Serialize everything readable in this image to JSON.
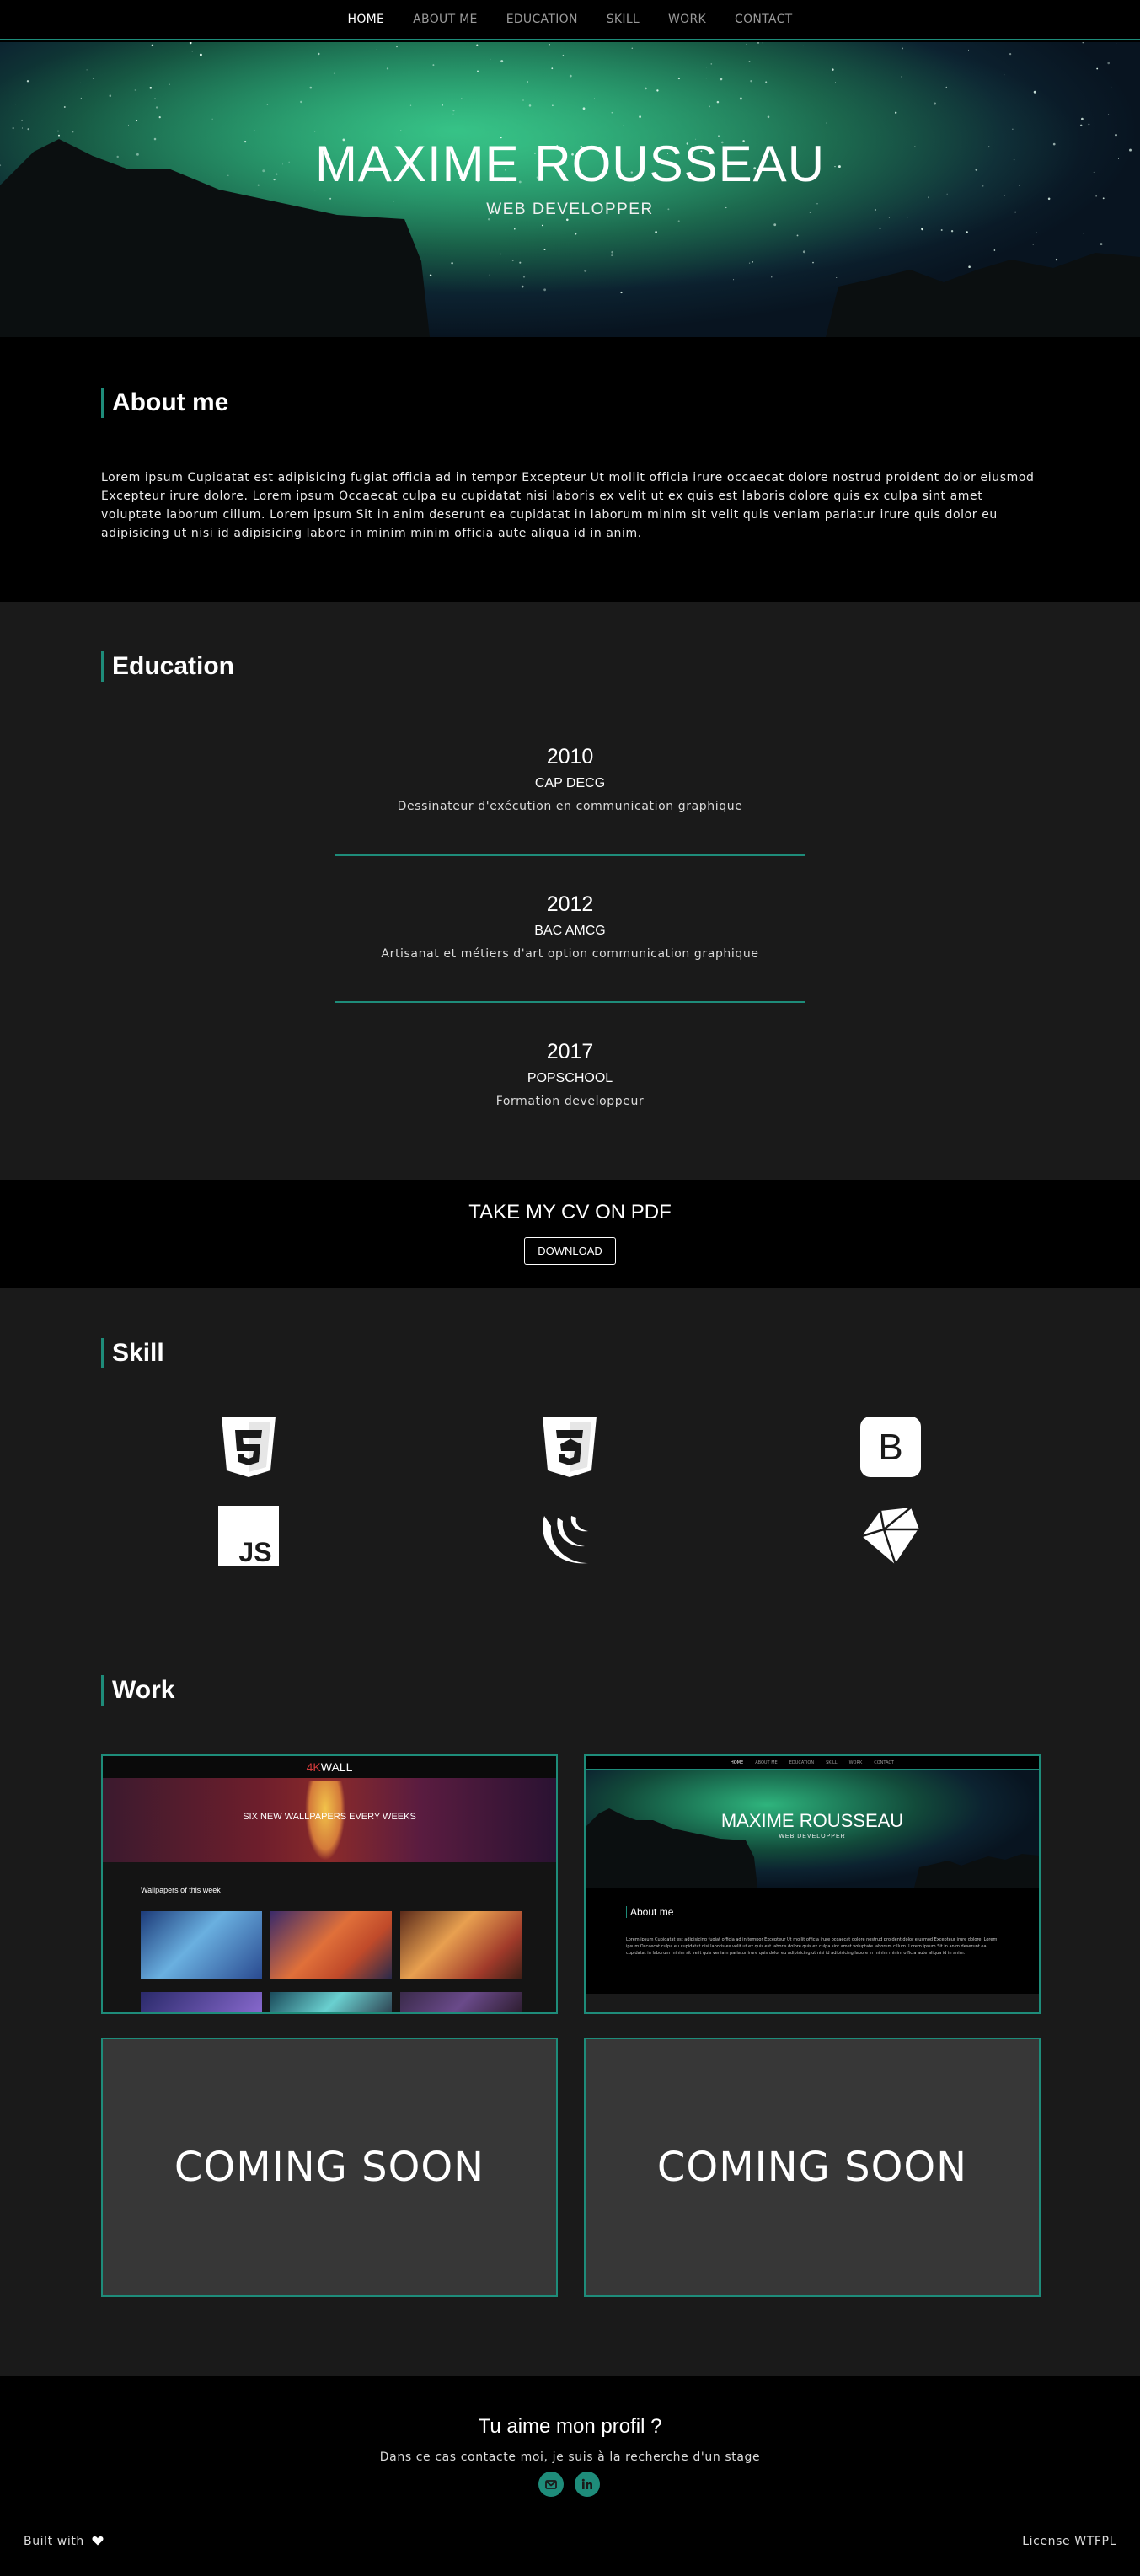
{
  "nav": {
    "items": [
      {
        "label": "HOME",
        "active": true
      },
      {
        "label": "ABOUT ME",
        "active": false
      },
      {
        "label": "EDUCATION",
        "active": false
      },
      {
        "label": "SKILL",
        "active": false
      },
      {
        "label": "WORK",
        "active": false
      },
      {
        "label": "CONTACT",
        "active": false
      }
    ]
  },
  "hero": {
    "name": "MAXIME ROUSSEAU",
    "subtitle": "WEB DEVELOPPER"
  },
  "about": {
    "title": "About me",
    "text": "Lorem ipsum Cupidatat est adipisicing fugiat officia ad in tempor Excepteur Ut mollit officia irure occaecat dolore nostrud proident dolor eiusmod Excepteur irure dolore. Lorem ipsum Occaecat culpa eu cupidatat nisi laboris ex velit ut ex quis est laboris dolore quis ex culpa sint amet voluptate laborum cillum. Lorem ipsum Sit in anim deserunt ea cupidatat in laborum minim sit velit quis veniam pariatur irure quis dolor eu adipisicing ut nisi id adipisicing labore in minim minim officia aute aliqua id in anim."
  },
  "education": {
    "title": "Education",
    "items": [
      {
        "year": "2010",
        "name": "CAP DECG",
        "desc": "Dessinateur d'exécution en communication graphique"
      },
      {
        "year": "2012",
        "name": "BAC AMCG",
        "desc": "Artisanat et métiers d'art option communication graphique"
      },
      {
        "year": "2017",
        "name": "POPSCHOOL",
        "desc": "Formation developpeur"
      }
    ]
  },
  "cv": {
    "title": "TAKE MY CV ON PDF",
    "button": "DOWNLOAD"
  },
  "skill": {
    "title": "Skill",
    "icons": [
      "html5-icon",
      "css3-icon",
      "bootstrap-icon",
      "javascript-icon",
      "jquery-icon",
      "ruby-icon"
    ]
  },
  "work": {
    "title": "Work",
    "card1": {
      "logo_accent": "4K",
      "logo": "WALL",
      "banner": "SIX NEW WALLPAPERS EVERY WEEKS",
      "section": "Wallpapers of this week"
    },
    "card2": {
      "nav": [
        "HOME",
        "ABOUT ME",
        "EDUCATION",
        "SKILL",
        "WORK",
        "CONTACT"
      ],
      "name": "MAXIME ROUSSEAU",
      "subtitle": "WEB DEVELOPPER",
      "about": "About me",
      "text": "Lorem ipsum Cupidatat est adipisicing fugiat officia ad in tempor Excepteur Ut mollit officia irure occaecat dolore nostrud proident dolor eiusmod Excepteur irure dolore. Lorem ipsum Occaecat culpa eu cupidatat nisi laboris ex velit ut ex quis est laboris dolore quis ex culpa sint amet voluptate laborum cillum. Lorem ipsum Sit in anim deserunt ea cupidatat in laborum minim sit velit quis veniam pariatur irure quis dolor eu adipisicing ut nisi id adipisicing labore in minim minim officia aute aliqua id in anim."
    },
    "soon": "COMING SOON"
  },
  "footer": {
    "title": "Tu aime mon profil ?",
    "subtitle": "Dans ce cas contacte moi, je suis à la recherche d'un stage",
    "built": "Built with",
    "license": "License WTFPL",
    "social": [
      "mail-icon",
      "linkedin-icon"
    ]
  },
  "colors": {
    "accent": "#1e8c7a",
    "dark": "#1a1a1a",
    "black": "#000000",
    "card_grey": "#373737"
  }
}
